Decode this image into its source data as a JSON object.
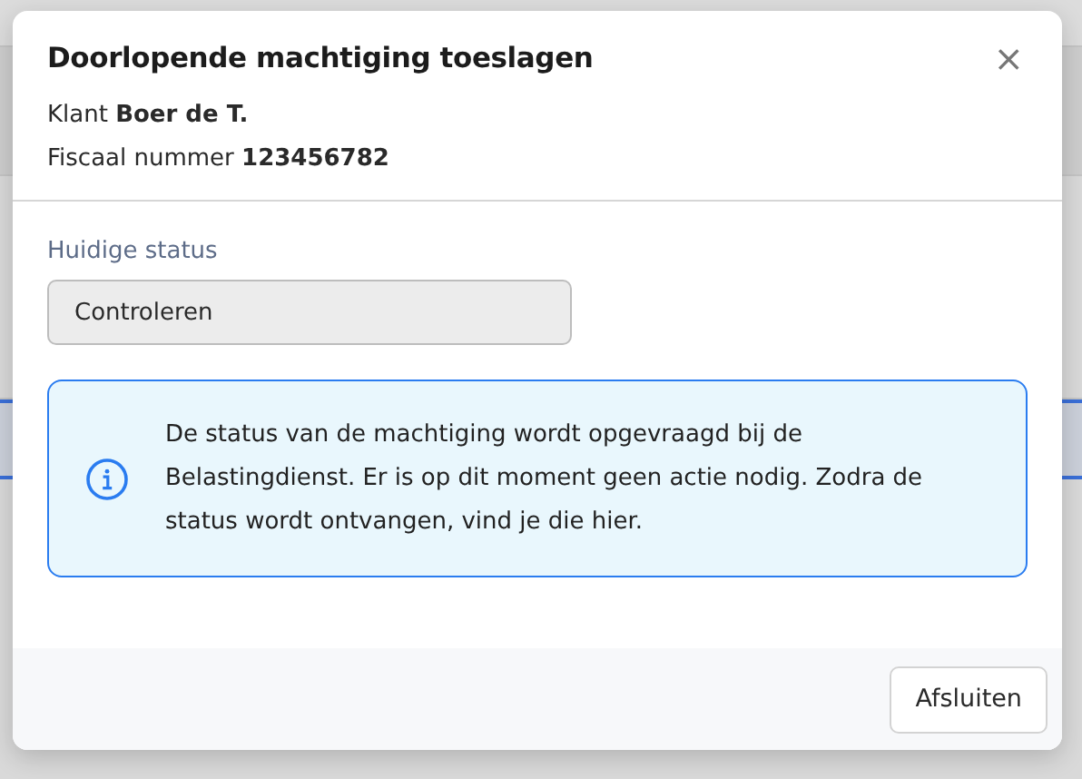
{
  "dialog": {
    "title": "Doorlopende machtiging toeslagen",
    "close": "×",
    "details": [
      "Klant **Boer de T.**",
      "Fiscaal nummer **123456782**"
    ],
    "status": {
      "label": "Huidige status",
      "value": "Controleren",
      "disabled": true
    },
    "notice": {
      "kind": "info",
      "text": "De status van de machtiging wordt opgevraagd bij de Belastingdienst. Er is op dit moment geen actie nodig. Zodra de status wordt ontvangen, vind je die hier."
    },
    "buttons": [
      "Afsluiten"
    ]
  }
}
